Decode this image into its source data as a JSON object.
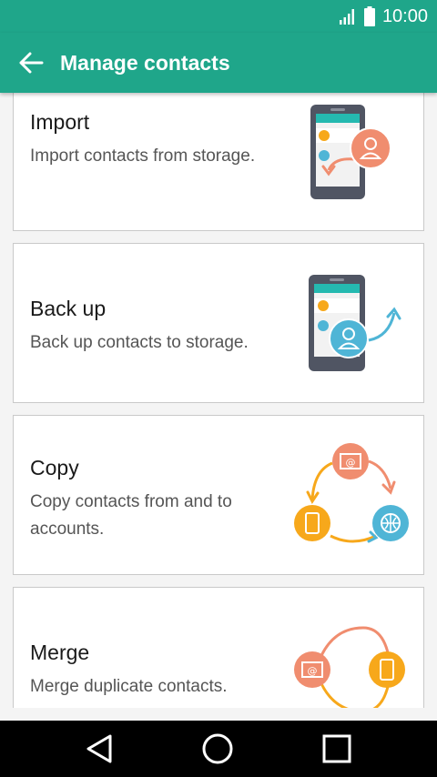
{
  "status_bar": {
    "time": "10:00",
    "icons": [
      "signal-icon",
      "battery-icon"
    ]
  },
  "app_bar": {
    "title": "Manage contacts",
    "back_icon": "arrow-left-icon"
  },
  "options": [
    {
      "title": "Import",
      "description": "Import contacts from storage.",
      "illustration": "phone-import-illustration"
    },
    {
      "title": "Back up",
      "description": "Back up contacts to storage.",
      "illustration": "phone-backup-illustration"
    },
    {
      "title": "Copy",
      "description": "Copy contacts from and to accounts.",
      "illustration": "accounts-cycle-illustration"
    },
    {
      "title": "Merge",
      "description": "Merge duplicate contacts.",
      "illustration": "merge-illustration"
    }
  ],
  "nav_bar": {
    "buttons": [
      "back-triangle-icon",
      "home-circle-icon",
      "recents-square-icon"
    ]
  },
  "colors": {
    "accent": "#1fa68a",
    "orange": "#f08d6f",
    "yellow": "#f7a81b",
    "blue": "#4fb5d6",
    "phone": "#505563",
    "phone_screen_header": "#25b9b0"
  }
}
